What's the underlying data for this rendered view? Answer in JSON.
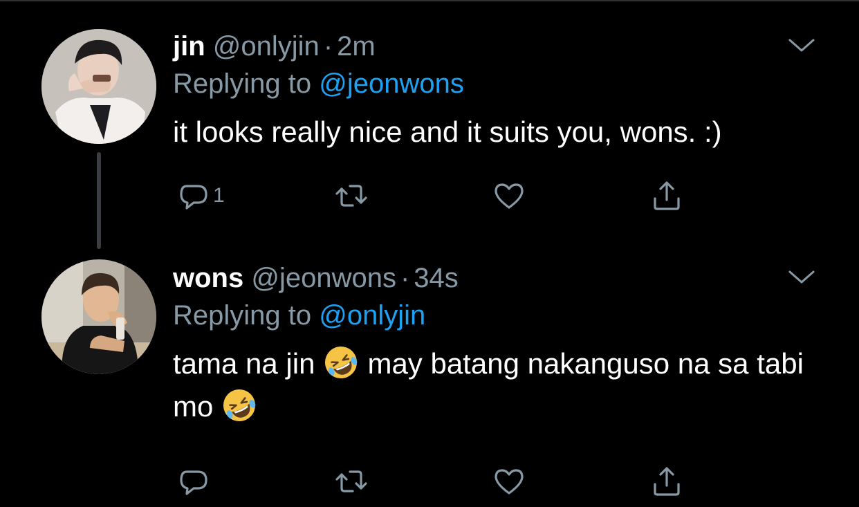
{
  "tweets": [
    {
      "name": "jin",
      "handle": "@onlyjin",
      "separator": "·",
      "time": "2m",
      "replying_prefix": "Replying to",
      "replying_to": "@jeonwons",
      "text": "it looks really nice and it suits you, wons. :)",
      "reply_count": "1"
    },
    {
      "name": "wons",
      "handle": "@jeonwons",
      "separator": "·",
      "time": "34s",
      "replying_prefix": "Replying to",
      "replying_to": "@onlyjin",
      "text_part1": "tama na jin",
      "text_part2": "may batang nakanguso na sa tabi mo",
      "emoji": "rolling-on-the-floor-laughing",
      "reply_count": ""
    }
  ],
  "icons": {
    "reply": "reply-icon",
    "retweet": "retweet-icon",
    "like": "heart-icon",
    "share": "share-icon",
    "caret": "chevron-down-icon"
  },
  "colors": {
    "background": "#000000",
    "primary_text": "#ffffff",
    "secondary_text": "#8899a6",
    "accent": "#1da1f2",
    "thread_line": "#3a3d41"
  }
}
